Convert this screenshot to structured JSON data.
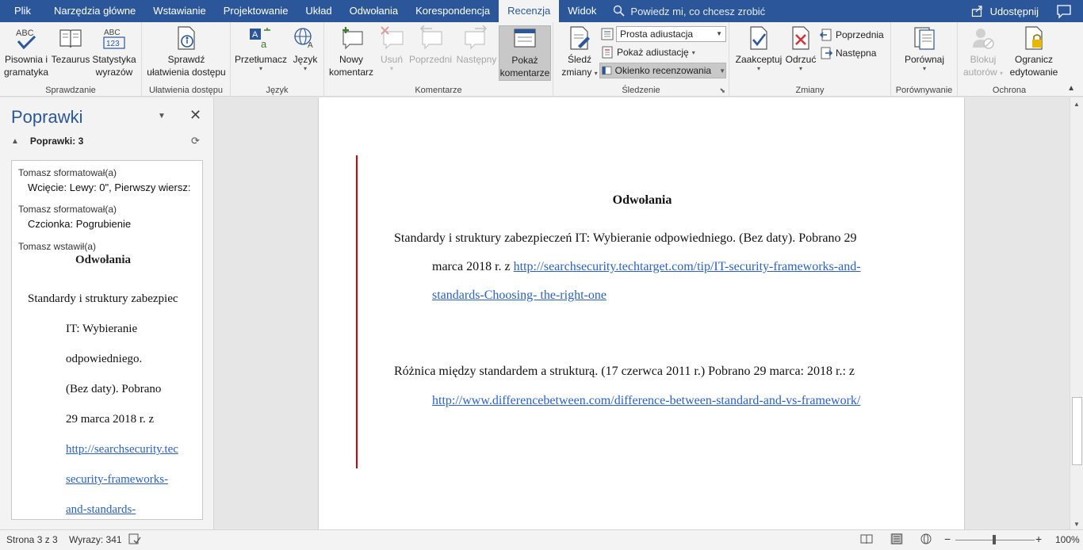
{
  "tabs": [
    "Plik",
    "Narzędzia główne",
    "Wstawianie",
    "Projektowanie",
    "Układ",
    "Odwołania",
    "Korespondencja",
    "Recenzja",
    "Widok"
  ],
  "active_tab": "Recenzja",
  "tell_me": "Powiedz mi, co chcesz zrobić",
  "share": "Udostępnij",
  "ribbon": {
    "spelling": "Pisownia i",
    "spelling2": "gramatyka",
    "thesaurus": "Tezaurus",
    "stats": "Statystyka",
    "stats2": "wyrazów",
    "group_proofing": "Sprawdzanie",
    "accessibility": "Sprawdź",
    "accessibility2": "ułatwienia dostępu",
    "group_accessibility": "Ułatwienia dostępu",
    "translate": "Przetłumacz",
    "language": "Język",
    "group_language": "Język",
    "new_comment": "Nowy",
    "new_comment2": "komentarz",
    "delete": "Usuń",
    "previous": "Poprzedni",
    "next": "Następny",
    "show_comments": "Pokaż",
    "show_comments2": "komentarze",
    "group_comments": "Komentarze",
    "track_changes": "Śledź",
    "track_changes2": "zmiany",
    "markup_mode": "Prosta adiustacja",
    "show_markup": "Pokaż adiustację",
    "reviewing_pane": "Okienko recenzowania",
    "group_tracking": "Śledzenie",
    "accept": "Zaakceptuj",
    "reject": "Odrzuć",
    "prev_change": "Poprzednia",
    "next_change": "Następna",
    "group_changes": "Zmiany",
    "compare": "Porównaj",
    "group_compare": "Porównywanie",
    "block_authors": "Blokuj",
    "block_authors2": "autorów",
    "restrict": "Ogranicz",
    "restrict2": "edytowanie",
    "group_protect": "Ochrona"
  },
  "pane": {
    "title": "Poprawki",
    "count": "Poprawki: 3",
    "rev1_author": "Tomasz sformatował(a)",
    "rev1_detail": "Wcięcie: Lewy: 0\", Pierwszy wiersz:",
    "rev2_author": "Tomasz sformatował(a)",
    "rev2_detail": "Czcionka: Pogrubienie",
    "rev3_author": "Tomasz wstawił(a)",
    "rev3_heading": "Odwołania",
    "rev3_lines": [
      "Standardy i struktury zabezpiec",
      "IT: Wybieranie",
      "odpowiedniego.",
      "(Bez daty). Pobrano",
      "29 marca 2018 r. z"
    ],
    "rev3_links": [
      "http://searchsecurity.tec",
      "security-frameworks-",
      "and-standards-"
    ]
  },
  "document": {
    "heading": "Odwołania",
    "ref1_line1": "Standardy i struktury zabezpieczeń IT: Wybieranie odpowiedniego. (Bez daty). Pobrano 29",
    "ref1_line2_text": "marca 2018 r. z ",
    "ref1_line2_link": "http://searchsecurity.techtarget.com/tip/IT-security-frameworks-and-",
    "ref1_line3_link": "standards-Choosing- the-right-one",
    "ref2_line1": "Różnica między standardem a strukturą. (17 czerwca 2011 r.) Pobrano 29 marca: 2018 r.: z",
    "ref2_line2_link": "http://www.differencebetween.com/difference-between-standard-and-vs-framework/"
  },
  "status": {
    "page": "Strona 3 z 3",
    "words": "Wyrazy: 341",
    "zoom": "100%"
  },
  "colors": {
    "accent": "#2b579a",
    "change_bar": "#d00000",
    "link": "#2b61c4"
  }
}
